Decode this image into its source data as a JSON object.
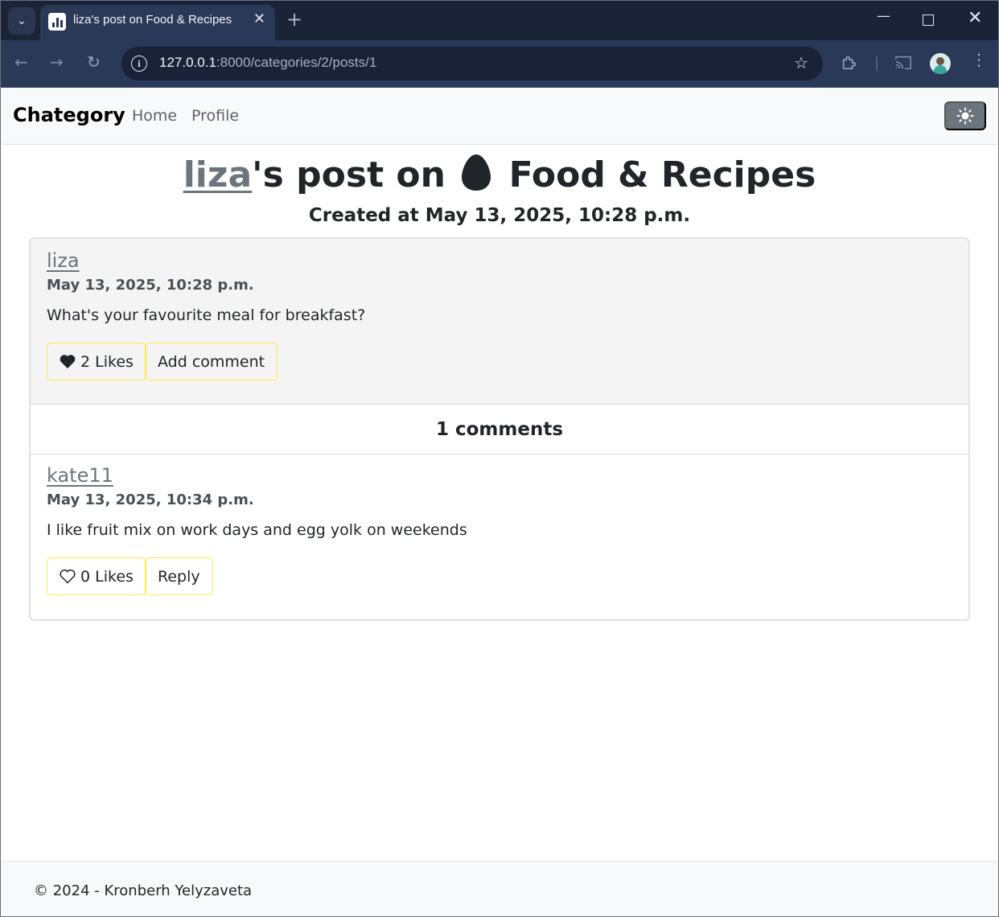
{
  "browser": {
    "tab_title": "liza's post on Food & Recipes",
    "new_tab_icon": "plus-icon",
    "url_host": "127.0.0.1",
    "url_rest": ":8000/categories/2/posts/1"
  },
  "site": {
    "brand": "Chategory",
    "nav": {
      "home": "Home",
      "profile": "Profile"
    },
    "theme_toggle_icon": "sun-icon"
  },
  "heading": {
    "author": "liza",
    "post_on": "'s post on",
    "category": "Food & Recipes",
    "category_icon": "egg-icon",
    "created": "Created at May 13, 2025, 10:28 p.m."
  },
  "post": {
    "author": "liza",
    "date": "May 13, 2025, 10:28 p.m.",
    "text": "What's your favourite meal for breakfast?",
    "likes_label": "2 Likes",
    "liked": true,
    "add_comment_label": "Add comment"
  },
  "comments": {
    "header": "1 comments",
    "items": [
      {
        "author": "kate11",
        "date": "May 13, 2025, 10:34 p.m.",
        "text": "I like fruit mix on work days and egg yolk on weekends",
        "likes_label": "0 Likes",
        "liked": false,
        "reply_label": "Reply"
      }
    ]
  },
  "footer": {
    "text": "© 2024 - Kronberh Yelyzaveta"
  },
  "colors": {
    "chrome_dark": "#1b2337",
    "chrome_toolbar": "#2b3958",
    "link_muted": "#6c757d",
    "button_outline": "#ffe84a",
    "navbar_bg": "#f8f9fa"
  }
}
